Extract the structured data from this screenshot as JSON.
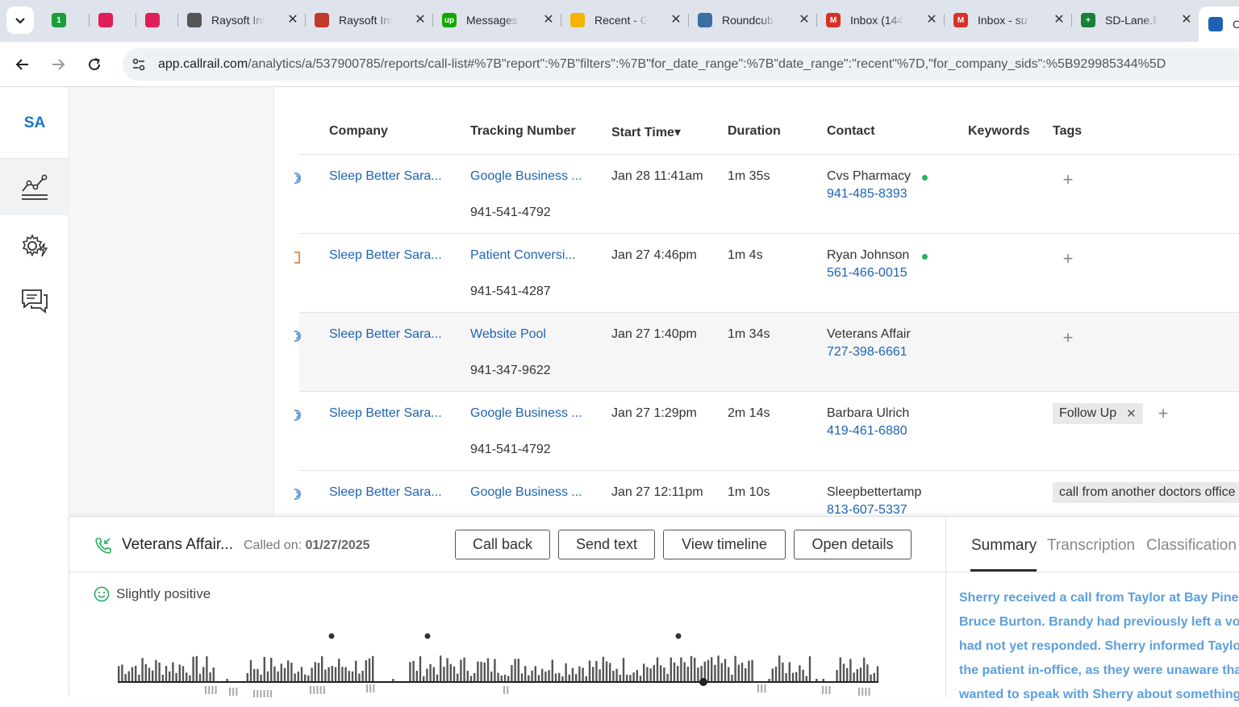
{
  "browser": {
    "tabs": [
      {
        "title": "",
        "favicon": "1password-icon",
        "color": "#1a9e3b",
        "glyph": "1"
      },
      {
        "title": "",
        "favicon": "slack-icon",
        "color": "#e01e5a",
        "glyph": ""
      },
      {
        "title": "",
        "favicon": "slack-icon",
        "color": "#e01e5a",
        "glyph": ""
      },
      {
        "title": "Raysoft Inf",
        "favicon": "globe-icon",
        "color": "#555555",
        "glyph": ""
      },
      {
        "title": "Raysoft Inf",
        "favicon": "raysoft-icon",
        "color": "#c0392b",
        "glyph": ""
      },
      {
        "title": "Messages",
        "favicon": "upwork-icon",
        "color": "#14a800",
        "glyph": "up"
      },
      {
        "title": "Recent - G",
        "favicon": "google-drive-icon",
        "color": "#f4b400",
        "glyph": ""
      },
      {
        "title": "Roundcub",
        "favicon": "roundcube-icon",
        "color": "#3a6ea5",
        "glyph": ""
      },
      {
        "title": "Inbox (144",
        "favicon": "gmail-icon",
        "color": "#d93025",
        "glyph": "M"
      },
      {
        "title": "Inbox - su",
        "favicon": "gmail-icon",
        "color": "#d93025",
        "glyph": "M"
      },
      {
        "title": "SD-Lane.R",
        "favicon": "google-sheets-icon",
        "color": "#188038",
        "glyph": "+"
      },
      {
        "title": "C",
        "favicon": "callrail-icon",
        "color": "#1e63b3",
        "glyph": ""
      }
    ],
    "url_domain": "app.callrail.com",
    "url_path": "/analytics/a/537900785/reports/call-list#%7B\"report\":%7B\"filters\":%7B\"for_date_range\":%7B\"date_range\":\"recent\"%7D,\"for_company_sids\":%5B929985344%5D"
  },
  "rail": {
    "logo": "SA"
  },
  "table": {
    "headers": {
      "company": "Company",
      "tracking_number": "Tracking Number",
      "start_time": "Start Time▾",
      "duration": "Duration",
      "contact": "Contact",
      "keywords": "Keywords",
      "tags": "Tags"
    },
    "rows": [
      {
        "company": "Sleep Better Sara...",
        "source": "Google Business ...",
        "number": "941-541-4792",
        "start": "Jan 28 11:41am",
        "duration": "1m 35s",
        "contact": "Cvs Pharmacy",
        "phone": "941-485-8393",
        "online": true,
        "tags": [],
        "tag_overflow": ""
      },
      {
        "company": "Sleep Better Sara...",
        "source": "Patient Conversi...",
        "number": "941-541-4287",
        "start": "Jan 27 4:46pm",
        "duration": "1m 4s",
        "contact": "Ryan Johnson",
        "phone": "561-466-0015",
        "online": true,
        "tags": [],
        "tag_overflow": ""
      },
      {
        "company": "Sleep Better Sara...",
        "source": "Website Pool",
        "number": "941-347-9622",
        "start": "Jan 27 1:40pm",
        "duration": "1m 34s",
        "contact": "Veterans Affair",
        "phone": "727-398-6661",
        "online": false,
        "tags": [],
        "tag_overflow": ""
      },
      {
        "company": "Sleep Better Sara...",
        "source": "Google Business ...",
        "number": "941-541-4792",
        "start": "Jan 27 1:29pm",
        "duration": "2m 14s",
        "contact": "Barbara Ulrich",
        "phone": "419-461-6880",
        "online": false,
        "tags": [
          "Follow Up"
        ],
        "tag_overflow": ""
      },
      {
        "company": "Sleep Better Sara...",
        "source": "Google Business ...",
        "number": "",
        "start": "Jan 27 12:11pm",
        "duration": "1m 10s",
        "contact": "Sleepbettertamp",
        "phone": "813-607-5337",
        "online": false,
        "tags": [],
        "tag_overflow": "call from another doctors office"
      }
    ]
  },
  "drawer": {
    "caller": "Veterans Affair...",
    "called_on_label": "Called on:",
    "called_on_date": "01/27/2025",
    "buttons": {
      "call_back": "Call back",
      "send_text": "Send text",
      "view_timeline": "View timeline",
      "open_details": "Open details"
    },
    "sentiment": "Slightly positive",
    "tabs": {
      "summary": "Summary",
      "transcription": "Transcription",
      "classification": "Classification"
    },
    "summary_lines": [
      "Sherry received a call from Taylor at Bay Pines",
      "Bruce Burton. Brandy had previously left a voic",
      "had not yet responded. Sherry informed Taylor",
      "the patient in-office, as they were unaware tha",
      "wanted to speak with Sherry about something"
    ]
  },
  "colors": {
    "link": "#1e63b3",
    "online_dot": "#27ae60",
    "summary_text": "#5b9fdc",
    "sentiment_face": "#27ae60"
  }
}
